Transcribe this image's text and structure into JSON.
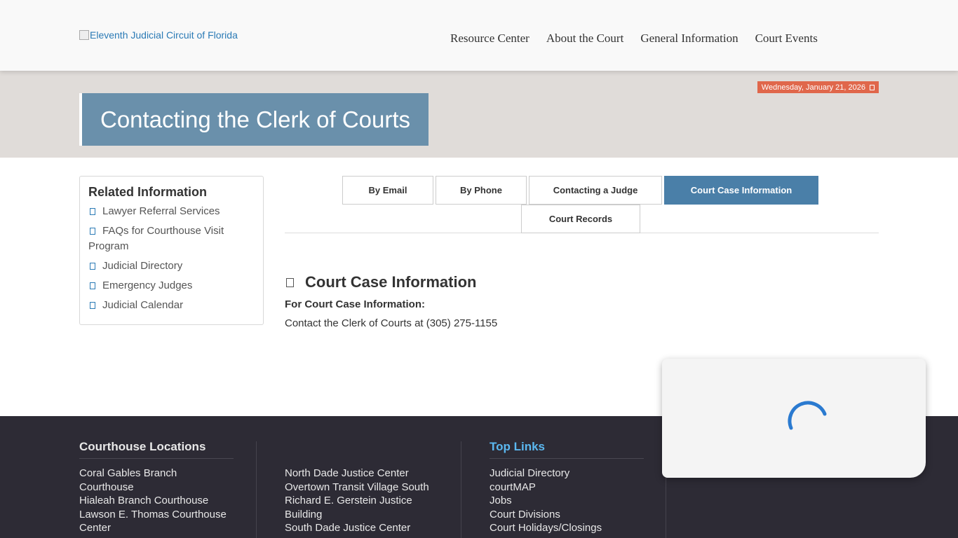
{
  "header": {
    "logo_alt": "Eleventh Judicial Circuit of Florida",
    "nav": [
      {
        "label": "Resource Center"
      },
      {
        "label": "About the Court"
      },
      {
        "label": "General Information"
      },
      {
        "label": "Court Events"
      }
    ]
  },
  "banner": {
    "date": "Wednesday, January 21, 2026",
    "date_icon": "calendar-icon",
    "title": "Contacting the Clerk of Courts"
  },
  "sidebar": {
    "title": "Related Information",
    "link_icon": "external-link-icon",
    "items": [
      {
        "label": "Lawyer Referral Services"
      },
      {
        "label": "FAQs for Courthouse Visit Program"
      },
      {
        "label": "Judicial Directory"
      },
      {
        "label": "Emergency Judges"
      },
      {
        "label": "Judicial Calendar"
      }
    ]
  },
  "tabs": {
    "items": [
      {
        "label": "By Email"
      },
      {
        "label": "By Phone"
      },
      {
        "label": "Contacting a Judge"
      },
      {
        "label": "Court Case Information"
      },
      {
        "label": "Court Records"
      }
    ],
    "active": "Court Case Information"
  },
  "content": {
    "heading": "Court Case Information",
    "heading_icon": "document-icon",
    "label": "For Court Case Information:",
    "text": "Contact the Clerk of Courts at (305) 275-1155"
  },
  "footer": {
    "locations_title": "Courthouse Locations",
    "locations_col1": [
      "Coral Gables Branch Courthouse",
      "Hialeah Branch Courthouse",
      "Lawson E. Thomas Courthouse Center"
    ],
    "locations_col2": [
      "North Dade Justice Center",
      "Overtown Transit Village South",
      "Richard E. Gerstein Justice Building",
      "South Dade Justice Center"
    ],
    "top_links_title": "Top Links",
    "top_links": [
      "Judicial Directory",
      "courtMAP",
      "Jobs",
      "Court Divisions",
      "Court Holidays/Closings"
    ]
  },
  "colors": {
    "accent": "#4a7fa8",
    "title_box": "#6a90ab",
    "date_badge": "#e0674b",
    "footer_bg": "#2d2b35",
    "top_links": "#5bb8f0"
  }
}
